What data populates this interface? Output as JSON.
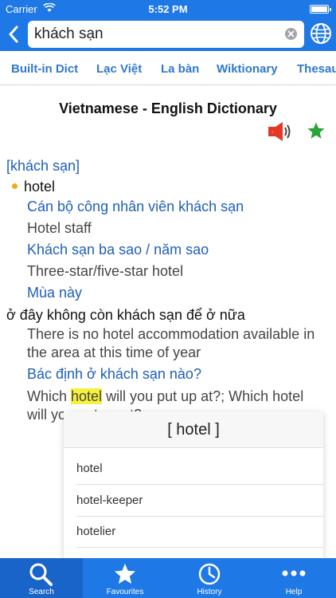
{
  "status_bar": {
    "carrier": "Carrier",
    "time": "5:52 PM",
    "battery_level": 0.9
  },
  "search": {
    "value": "khách sạn"
  },
  "tabs": [
    {
      "label": "Built-in Dict"
    },
    {
      "label": "Lạc Việt"
    },
    {
      "label": "La bàn"
    },
    {
      "label": "Wiktionary"
    },
    {
      "label": "Thesau"
    }
  ],
  "entry": {
    "title": "Vietnamese - English Dictionary",
    "headword": "[khách sạn]",
    "sense": "hotel",
    "lines": [
      "Cán bộ công nhân viên khách sạn",
      "Hotel staff",
      "Khách sạn ba sao / năm sao",
      "Three-star/five-star hotel",
      "Mùa này",
      "ở đây không còn khách sạn để ở nữa",
      "There is no hotel accommodation available in",
      "the area at this time of year",
      "Bác định ở khách sạn nào?"
    ],
    "example_before": "Which ",
    "example_highlight": "hotel",
    "example_after": " will you put up at?; Which hotel",
    "example_cont": "will you put up at?"
  },
  "popup": {
    "title": "[ hotel ]",
    "items": [
      "hotel",
      "hotel-keeper",
      "hotelier"
    ]
  },
  "tabbar": [
    {
      "label": "Search",
      "icon": "search-icon"
    },
    {
      "label": "Favourites",
      "icon": "star-icon"
    },
    {
      "label": "History",
      "icon": "clock-icon"
    },
    {
      "label": "Help",
      "icon": "more-icon"
    }
  ],
  "colors": {
    "primary": "#1e78e6",
    "link": "#1f5fb8",
    "highlight": "#f5f13c",
    "favourite": "#2aa33a"
  }
}
